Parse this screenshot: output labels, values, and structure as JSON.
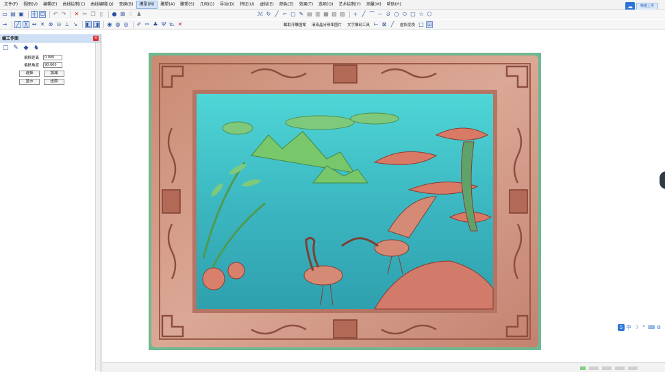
{
  "menubar": {
    "items": [
      "文件(F)",
      "视图(V)",
      "编辑(E)",
      "曲线绘制(C)",
      "曲线编辑(Q)",
      "变换(B)",
      "模型(M)",
      "雕塑(A)",
      "雕塑(S)",
      "几何(G)",
      "导动(D)",
      "特征(U)",
      "虚拟(E)",
      "颜色(Z)",
      "效果(T)",
      "选项(O)",
      "艺术绘制(Y)",
      "测量(M)",
      "帮助(H)"
    ],
    "active_index": 6,
    "cloud_label": "精雕上传"
  },
  "toolbar2": {
    "labels": [
      "截取浮雕图案",
      "清染晶分辨率图片",
      "文字雕刻工具",
      "虚拟变换"
    ]
  },
  "panel": {
    "title": "编工作面",
    "fields": [
      {
        "label": "偏移距离",
        "value": "0.000"
      },
      {
        "label": "偏移角度",
        "value": "90.000"
      }
    ],
    "buttons_row1": [
      "选择",
      "加减"
    ],
    "buttons_row2": [
      "显示",
      "还原"
    ]
  },
  "ime": {
    "label": "中"
  }
}
